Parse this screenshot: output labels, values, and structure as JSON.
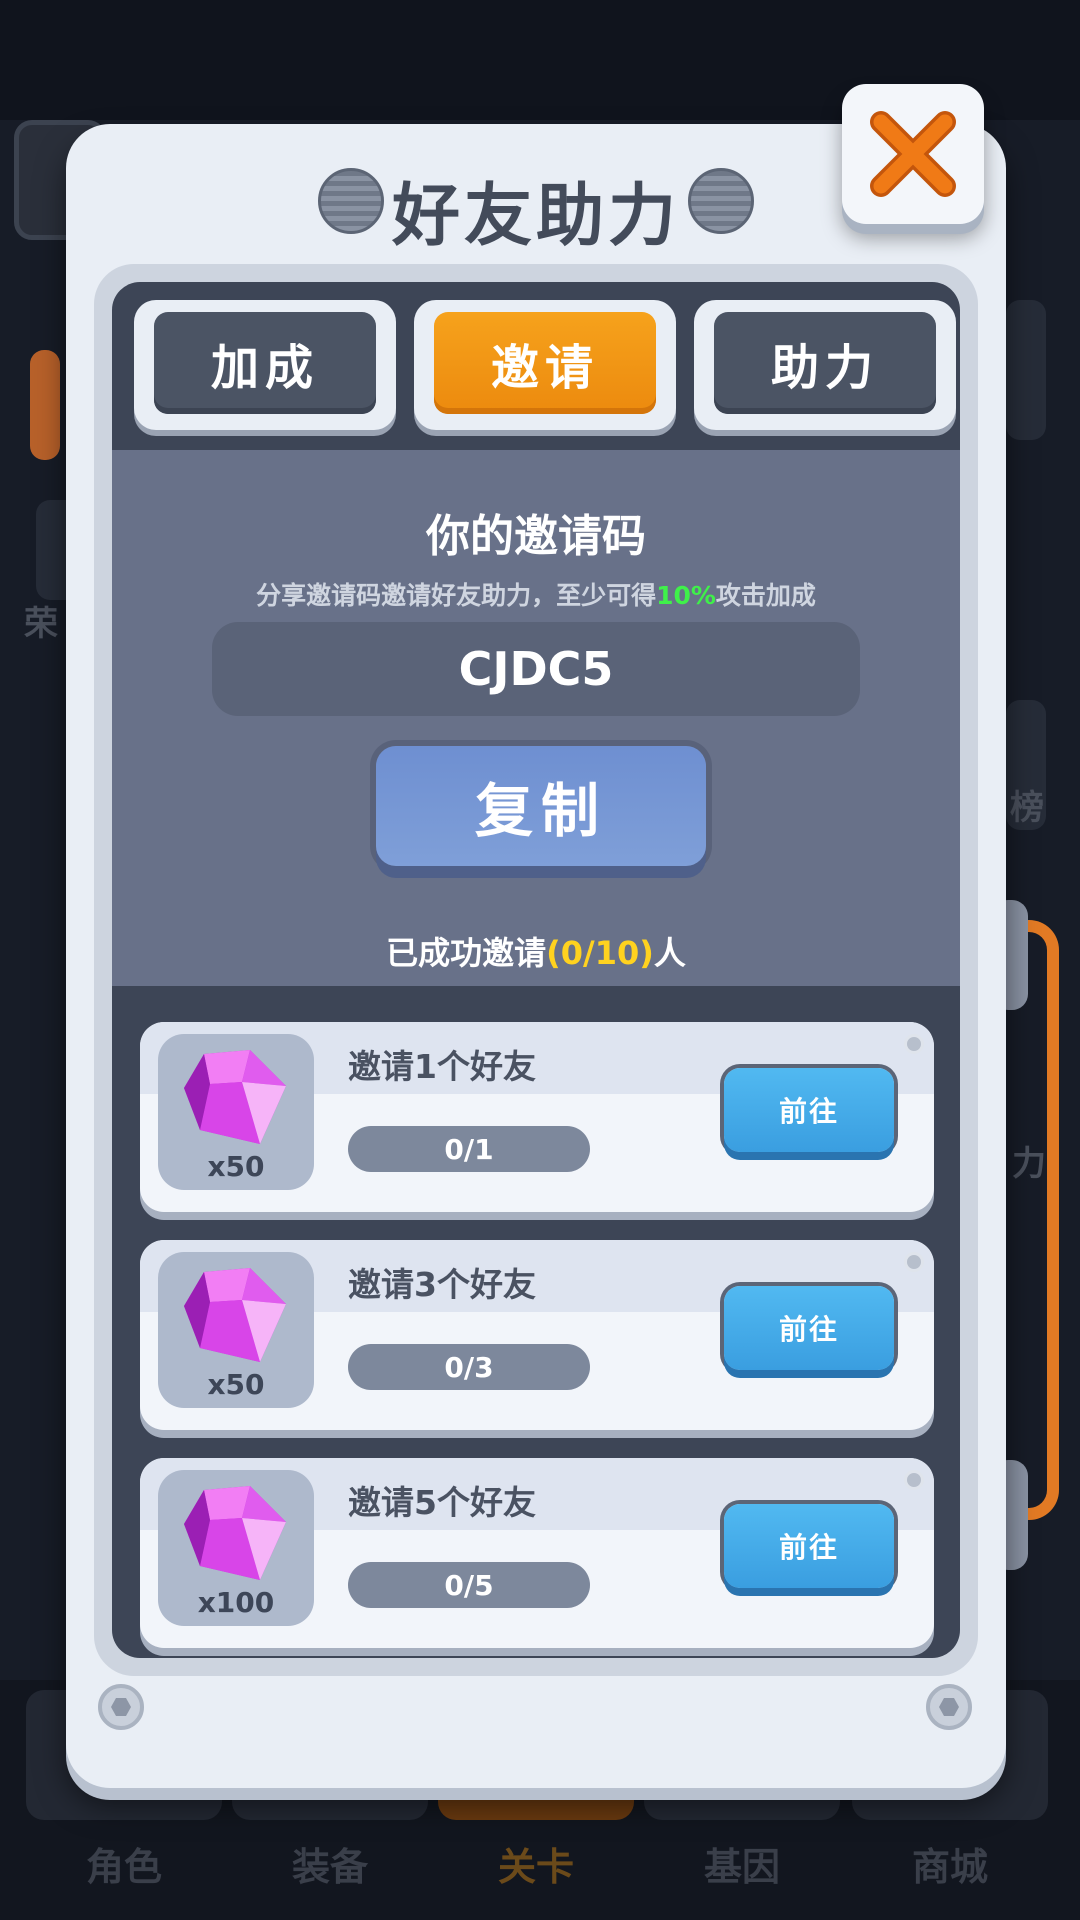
{
  "background": {
    "tabs": [
      {
        "label": "角色",
        "active": false
      },
      {
        "label": "装备",
        "active": false
      },
      {
        "label": "关卡",
        "active": true
      },
      {
        "label": "基因",
        "active": false
      },
      {
        "label": "商城",
        "active": false
      }
    ],
    "side_labels": [
      "荣",
      "榜",
      "力"
    ]
  },
  "dialog": {
    "title": "好友助力",
    "close_icon": "close-x-icon",
    "tabs": [
      {
        "label": "加成",
        "active": false
      },
      {
        "label": "邀请",
        "active": true
      },
      {
        "label": "助力",
        "active": false
      }
    ],
    "invite": {
      "heading": "你的邀请码",
      "desc_prefix": "分享邀请码邀请好友助力，至少可得",
      "desc_percent": "10%",
      "desc_suffix": "攻击加成",
      "code": "CJDC5",
      "copy_label": "复制",
      "count_prefix": "已成功邀请",
      "count_value": "(0/10)",
      "count_suffix": "人"
    },
    "rewards": [
      {
        "title": "邀请1个好友",
        "amount": "x50",
        "progress": "0/1",
        "button": "前往",
        "icon": "gem-icon"
      },
      {
        "title": "邀请3个好友",
        "amount": "x50",
        "progress": "0/3",
        "button": "前往",
        "icon": "gem-icon"
      },
      {
        "title": "邀请5个好友",
        "amount": "x100",
        "progress": "0/5",
        "button": "前往",
        "icon": "gem-icon"
      }
    ]
  },
  "colors": {
    "accent_orange": "#ec8a0e",
    "highlight_green": "#3ff04a",
    "count_yellow": "#ffd21f",
    "button_blue": "#3a9ee0"
  }
}
